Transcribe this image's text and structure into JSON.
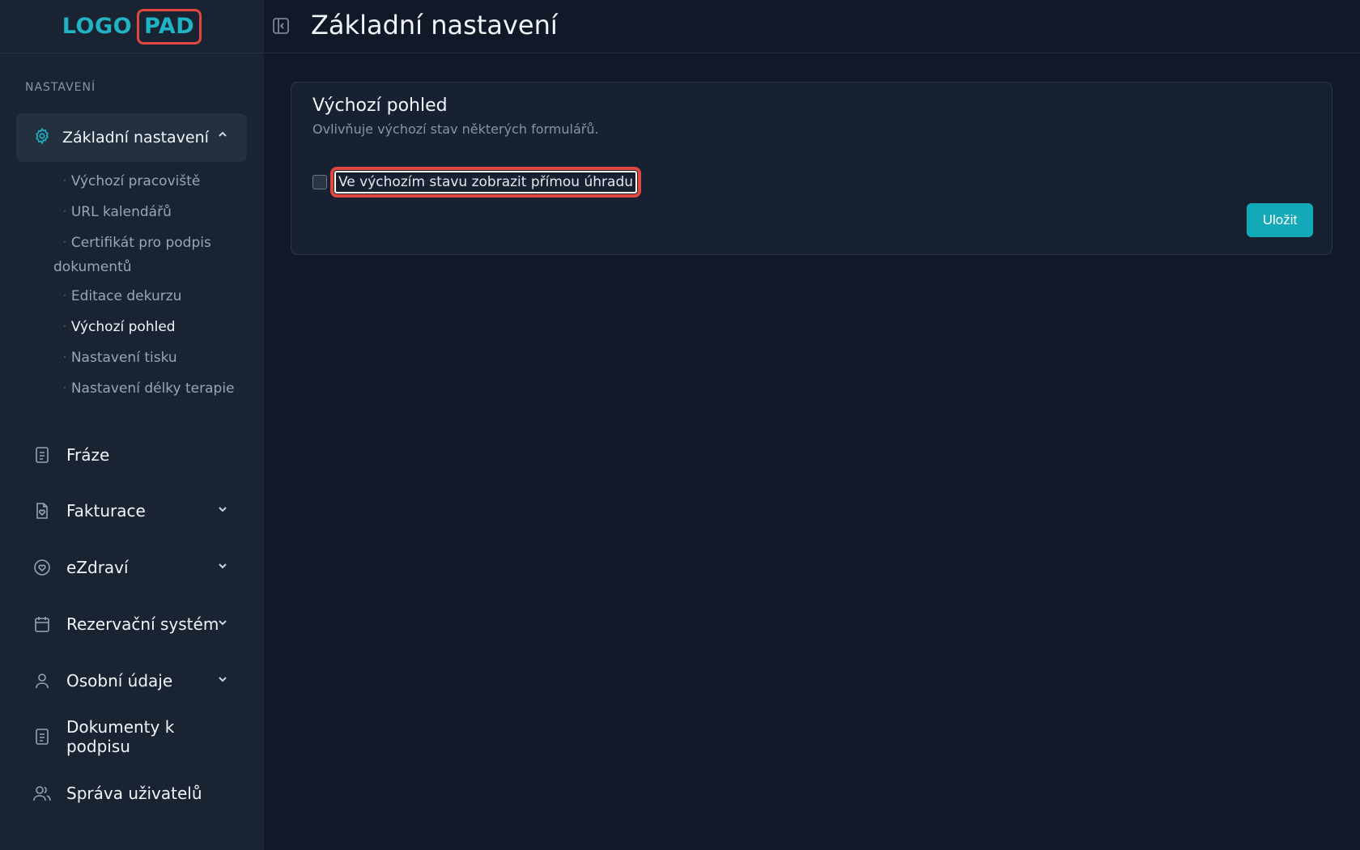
{
  "logo": {
    "part1": "LOGO",
    "part2": "PAD"
  },
  "sidebar": {
    "section_label": "NASTAVENÍ",
    "active_group": {
      "label": "Základní nastavení",
      "items": [
        {
          "label": "Výchozí pracoviště"
        },
        {
          "label": "URL kalendářů"
        },
        {
          "label": "Certifikát pro podpis dokumentů"
        },
        {
          "label": "Editace dekurzu"
        },
        {
          "label": "Výchozí pohled"
        },
        {
          "label": "Nastavení tisku"
        },
        {
          "label": "Nastavení délky terapie"
        }
      ]
    },
    "items": [
      {
        "label": "Fráze"
      },
      {
        "label": "Fakturace"
      },
      {
        "label": "eZdraví"
      },
      {
        "label": "Rezervační systém"
      },
      {
        "label": "Osobní údaje"
      },
      {
        "label": "Dokumenty k podpisu"
      },
      {
        "label": "Správa uživatelů"
      }
    ]
  },
  "header": {
    "title": "Základní nastavení"
  },
  "card": {
    "title": "Výchozí pohled",
    "subtitle": "Ovlivňuje výchozí stav některých formulářů.",
    "checkbox_label": "Ve výchozím stavu zobrazit přímou úhradu",
    "checkbox_checked": false,
    "save_label": "Uložit"
  },
  "colors": {
    "accent": "#13a9b8",
    "highlight": "#e0473e"
  }
}
